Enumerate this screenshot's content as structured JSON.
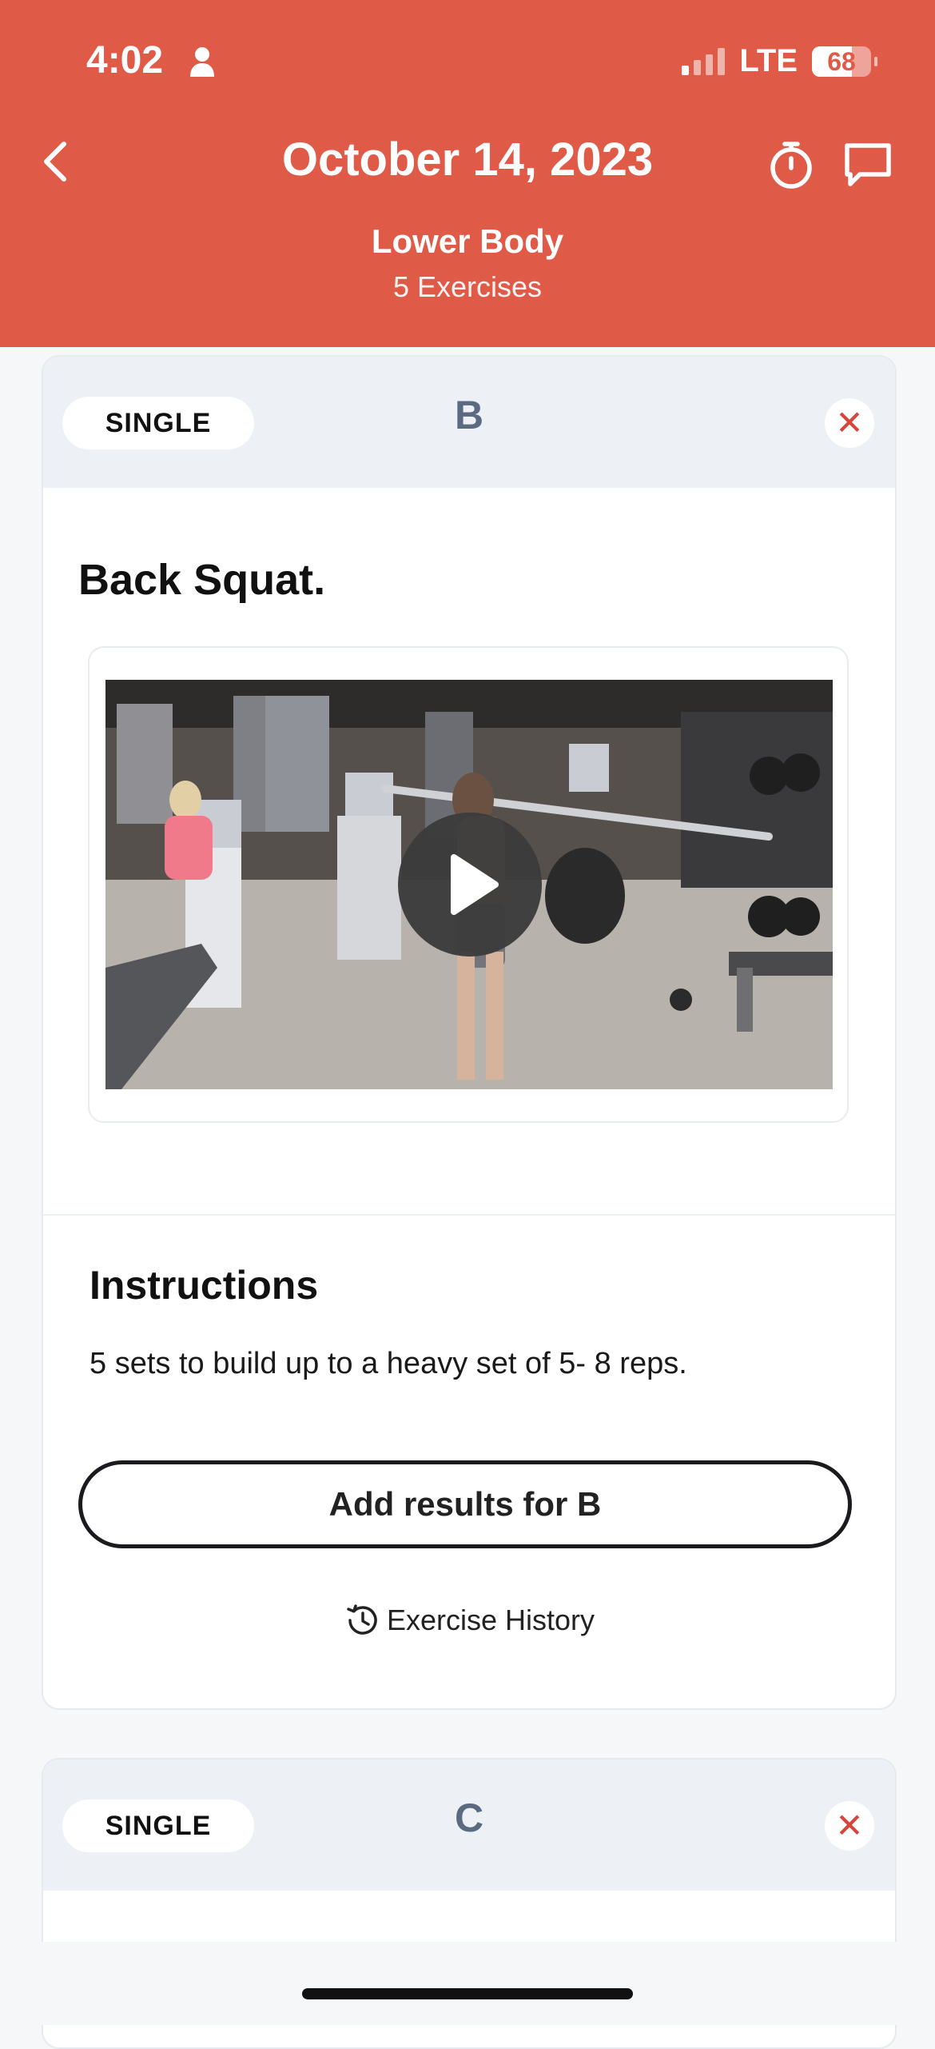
{
  "status_bar": {
    "time": "4:02",
    "network": "LTE",
    "battery": "68"
  },
  "header": {
    "date": "October 14, 2023",
    "workout_name": "Lower Body",
    "exercise_count": "5 Exercises"
  },
  "cards": [
    {
      "type_label": "SINGLE",
      "group_letter": "B",
      "close_symbol": "✕",
      "exercise_title": "Back Squat.",
      "instructions_title": "Instructions",
      "instructions_text": "5 sets to build up to a heavy set of 5- 8 reps.",
      "add_results_label": "Add results for B",
      "history_label": "Exercise History"
    },
    {
      "type_label": "SINGLE",
      "group_letter": "C",
      "close_symbol": "✕"
    }
  ],
  "colors": {
    "brand": "#e05a48",
    "close": "#d9443a",
    "letter": "#5a6a80"
  },
  "icons": [
    "back-chevron-icon",
    "stopwatch-icon",
    "chat-bubble-icon",
    "play-icon",
    "history-clock-icon",
    "person-icon"
  ]
}
